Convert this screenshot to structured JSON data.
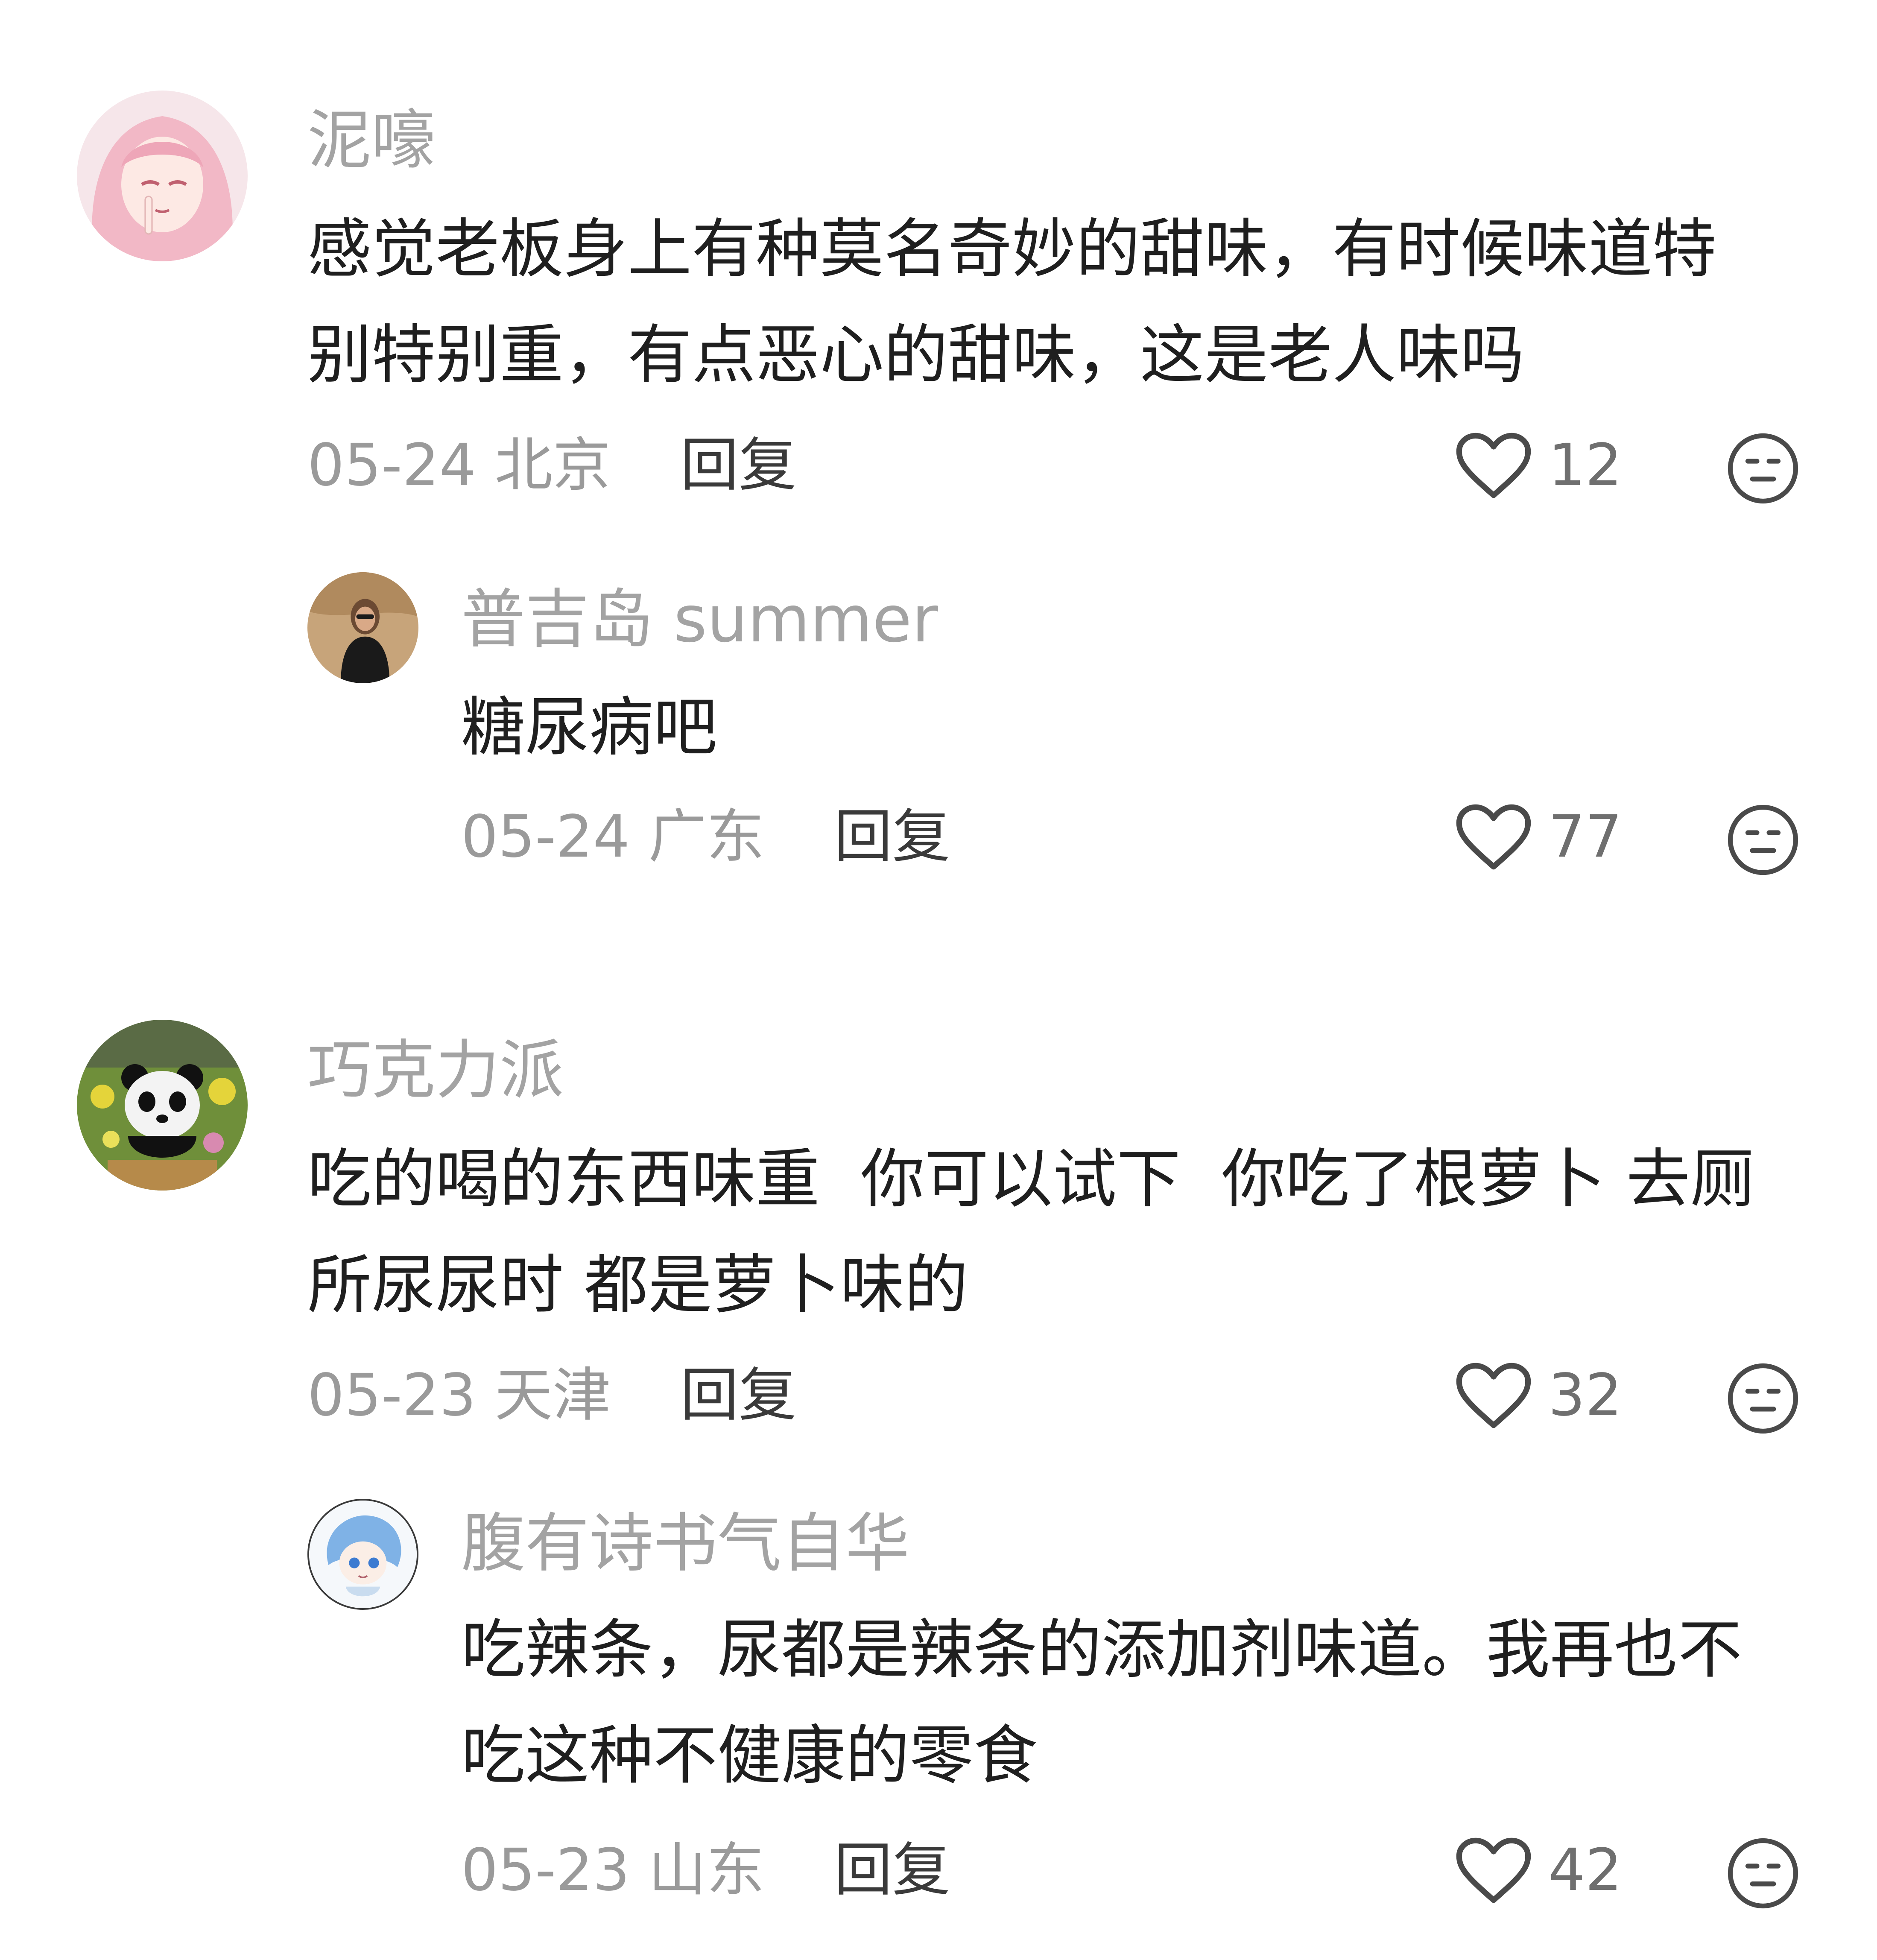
{
  "comments": [
    {
      "username": "泥嚎",
      "avatar_icon": "pink-hair-anime-avatar",
      "text_lines": [
        "感觉老板身上有种莫名奇妙的甜味，有时候味道特",
        "别特别重，有点恶心的甜味，这是老人味吗"
      ],
      "date": "05-24",
      "location": "北京",
      "reply_label": "回复",
      "likes": "12",
      "replies": [
        {
          "username": "普吉岛 summer",
          "avatar_icon": "woman-sunglasses-photo-avatar",
          "text_lines": [
            "糖尿病吧"
          ],
          "date": "05-24",
          "location": "广东",
          "reply_label": "回复",
          "likes": "77"
        }
      ]
    },
    {
      "username": "巧克力派",
      "avatar_icon": "panda-photo-avatar",
      "text_lines": [
        "吃的喝的东西味重  你可以试下  你吃了根萝卜 去厕",
        "所尿尿时 都是萝卜味的"
      ],
      "date": "05-23",
      "location": "天津",
      "reply_label": "回复",
      "likes": "32",
      "replies": [
        {
          "username": "腹有诗书气自华",
          "avatar_icon": "blue-hair-anime-avatar",
          "text_lines": [
            "吃辣条，尿都是辣条的添加剂味道。我再也不",
            "吃这种不健康的零食"
          ],
          "date": "05-23",
          "location": "山东",
          "reply_label": "回复",
          "likes": "42"
        }
      ]
    }
  ],
  "colors": {
    "username": "#a3a3a3",
    "body_text": "#1f1f1f",
    "meta": "#9a9a9a",
    "reply": "#3a3a3a",
    "icon_stroke": "#4a4a4a"
  }
}
